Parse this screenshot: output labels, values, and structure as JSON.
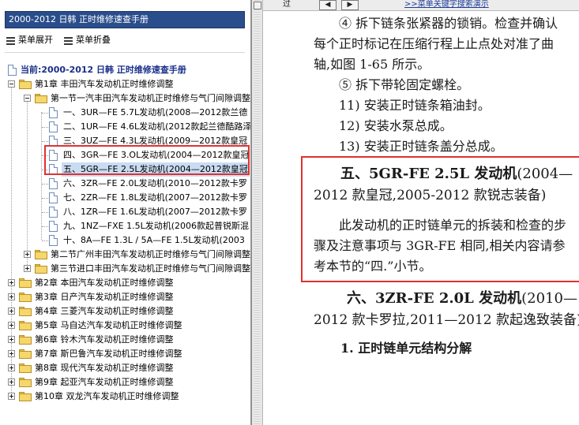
{
  "toc": {
    "title": "2000-2012 日韩 正时维修速查手册",
    "menu_expand": "菜单展开",
    "menu_collapse": "菜单折叠",
    "current_label": "当前:2000-2012 日韩 正时维修速查手册",
    "chapter1": "第1章 丰田汽车发动机正时维修调整",
    "section1": "第一节一汽丰田汽车发动机正时维修与气门间隙调整",
    "items": [
      "一、3UR—FE 5.7L发动机(2008—2012款兰德",
      "二、1UR—FE 4.6L发动机(2012款起兰德酷路泽",
      "三、3UZ—FE 4.3L发动机(2009—2012款皇冠",
      "四、3GR—FE 3.OL发动机(2004—2012款皇冠",
      "五、5GR—FE 2.5L发动机(2004—2012款皇冠",
      "六、3ZR—FE 2.0L发动机(2010—2012款卡罗",
      "七、2ZR—FE 1.8L发动机(2007—2012款卡罗",
      "八、1ZR—FE 1.6L发动机(2007—2012款卡罗",
      "九、1NZ—FXE 1.5L发动机(2006款起普锐斯混",
      "十、8A—FE 1.3L / 5A—FE 1.5L发动机(2003"
    ],
    "section2": "第二节广州丰田汽车发动机正时维修与气门间隙调整",
    "section3": "第三节进口丰田汽车发动机正时维修与气门间隙调整",
    "chapters": [
      "第2章 本田汽车发动机正时维修调整",
      "第3章 日产汽车发动机正时维修调整",
      "第4章 三菱汽车发动机正时维修调整",
      "第5章 马自达汽车发动机正时维修调整",
      "第6章 铃木汽车发动机正时维修调整",
      "第7章 斯巴鲁汽车发动机正时维修调整",
      "第8章 现代汽车发动机正时维修调整",
      "第9章 起亚汽车发动机正时维修调整",
      "第10章 双龙汽车发动机正时维修调整"
    ]
  },
  "top_strip": {
    "left_text": "过",
    "btn1": "◀",
    "btn2": "▶",
    "link": ">>菜单关键字搜索演示"
  },
  "doc": {
    "line1": "④ 拆下链条张紧器的锁销。检查并确认",
    "line2": "每个正时标记在压缩行程上止点处对准了曲",
    "line3": "轴,如图 1-65 所示。",
    "line4": "⑤ 拆下带轮固定螺栓。",
    "line5": "11) 安装正时链条箱油封。",
    "line6": "12) 安装水泵总成。",
    "line7": "13) 安装正时链条盖分总成。",
    "heading5_a": "五、5GR-FE 2.5L 发动机",
    "heading5_b": "(2004—",
    "heading5_c": "2012 款皇冠,2005-2012 款锐志装备)",
    "para1": "此发动机的正时链单元的拆装和检查的步",
    "para2": "骤及注意事项与 3GR-FE 相同,相关内容请参",
    "para3": "考本节的“四.”小节。",
    "heading6_a": "六、3ZR-FE 2.0L 发动机",
    "heading6_b": "(2010—",
    "heading6_c": "2012 款卡罗拉,2011—2012 款起逸致装备)",
    "sub1": "1. 正时链单元结构分解"
  }
}
